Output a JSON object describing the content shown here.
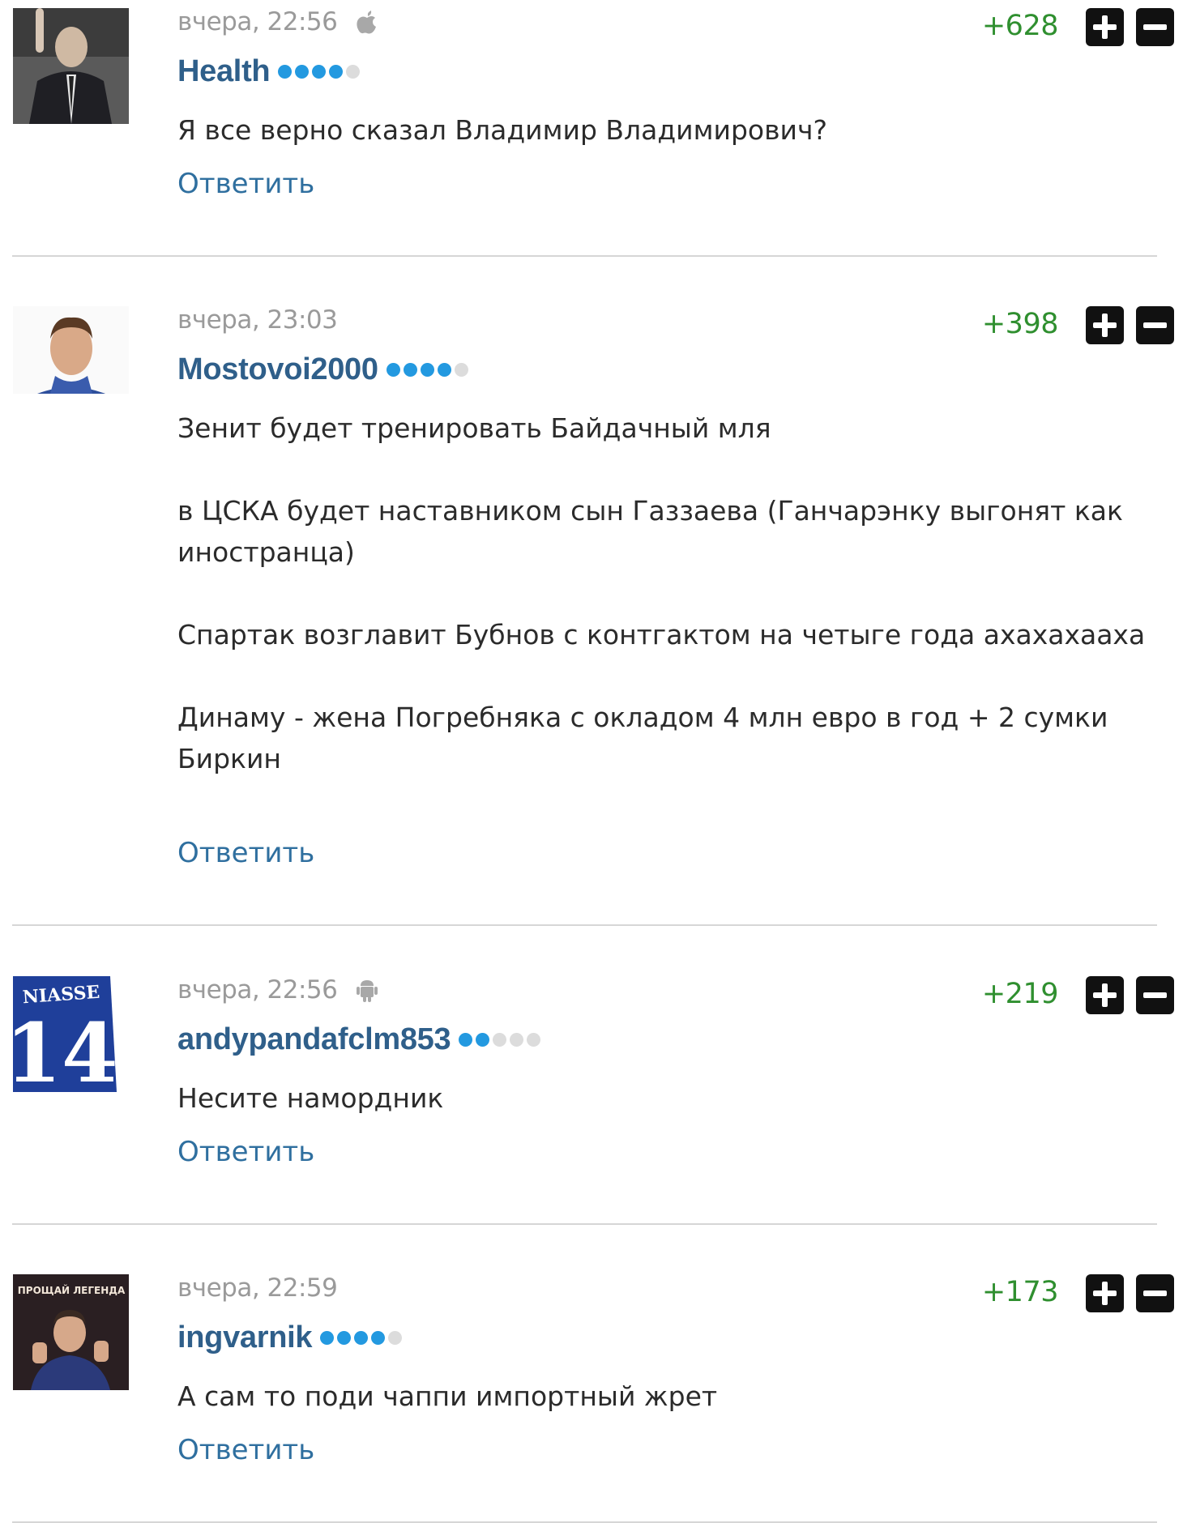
{
  "colors": {
    "rating_positive": "#2f8f2f",
    "username": "#2f5f8a",
    "reply_link": "#2f6f9f",
    "dot_active": "#2399e0",
    "dot_inactive": "#dcdcdc",
    "meta_text": "#9a9a9a"
  },
  "comments": [
    {
      "time": "вчера, 22:56",
      "device_icon": "apple-icon",
      "rating": "+628",
      "username": "Health",
      "rank_dots": {
        "active": 4,
        "total": 5
      },
      "text": "Я все верно сказал Владимир Владимирович?",
      "reply_label": "Ответить"
    },
    {
      "time": "вчера, 23:03",
      "device_icon": null,
      "rating": "+398",
      "username": "Mostovoi2000",
      "rank_dots": {
        "active": 4,
        "total": 5
      },
      "text": "Зенит будет тренировать Байдачный мля\n\nв ЦСКА будет наставником сын Газзаева (Ганчарэнку выгонят как иностранца)\n\nСпартак возглавит Бубнов с контгактом на четыге года ахахахааха\n\nДинаму - жена Погребняка с окладом 4 млн евро в год + 2 сумки Биркин",
      "reply_label": "Ответить"
    },
    {
      "time": "вчера, 22:56",
      "device_icon": "android-icon",
      "rating": "+219",
      "username": "andypandafclm853",
      "rank_dots": {
        "active": 2,
        "total": 5
      },
      "text": "Несите намордник",
      "reply_label": "Ответить"
    },
    {
      "time": "вчера, 22:59",
      "device_icon": null,
      "rating": "+173",
      "username": "ingvarnik",
      "rank_dots": {
        "active": 4,
        "total": 5
      },
      "text": "А сам то поди чаппи импортный жрет",
      "reply_label": "Ответить"
    }
  ]
}
